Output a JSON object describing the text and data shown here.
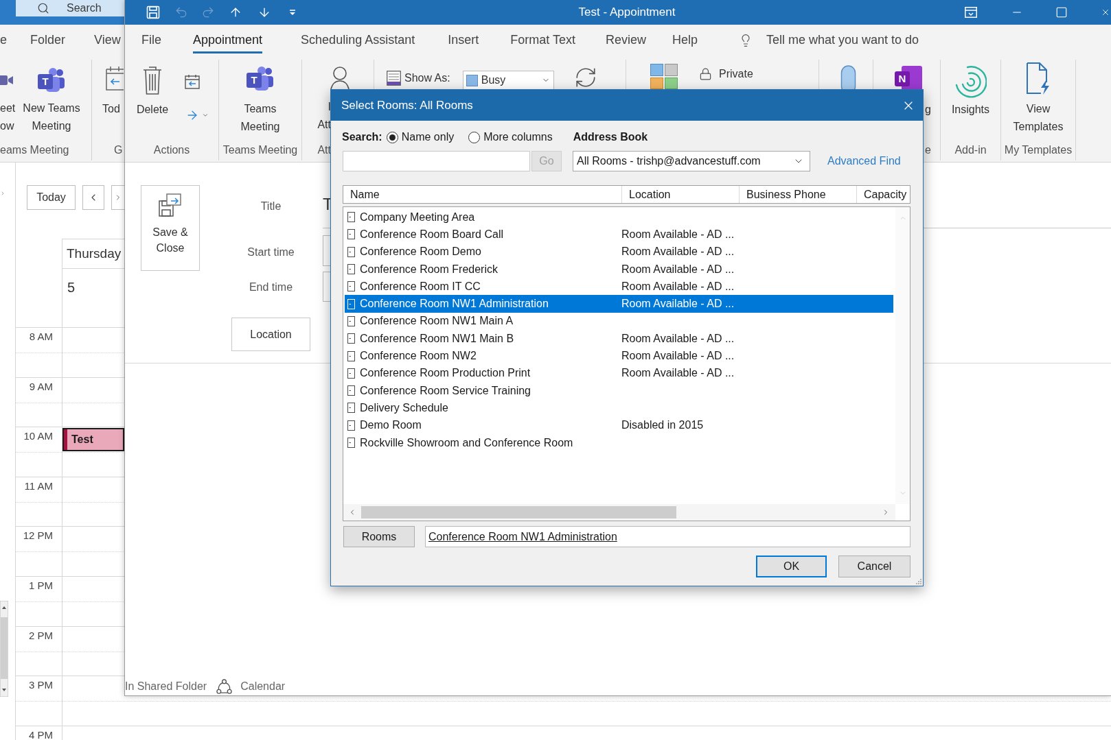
{
  "main_window": {
    "search": {
      "placeholder": "Search"
    },
    "tabs": [
      {
        "label": "e",
        "selected": false
      },
      {
        "label": "Folder",
        "selected": false
      },
      {
        "label": "View",
        "selected": false
      }
    ],
    "ribbon": {
      "buttons": [
        {
          "lines": [
            "eet",
            "ow"
          ]
        },
        {
          "lines": [
            "New Teams",
            "Meeting"
          ],
          "logo_letter": "T"
        },
        {
          "lines": [
            "Tod"
          ]
        }
      ],
      "groups": [
        "eams Meeting",
        "G"
      ]
    },
    "calendar": {
      "today_button": "Today",
      "day": {
        "weekday": "Thursday",
        "date": "5"
      },
      "hours": [
        {
          "label": "8 AM"
        },
        {
          "label": "9 AM"
        },
        {
          "label": "10 AM",
          "events": [
            {
              "title": "Test"
            }
          ]
        },
        {
          "label": "11 AM"
        },
        {
          "label": "12 PM"
        },
        {
          "label": "1 PM"
        },
        {
          "label": "2 PM"
        },
        {
          "label": "3 PM"
        },
        {
          "label": "4 PM"
        }
      ]
    }
  },
  "appointment_window": {
    "title": "Test - Appointment",
    "quick_access": [
      {
        "disabled": false
      },
      {
        "disabled": true
      },
      {
        "disabled": true
      },
      {
        "disabled": false
      },
      {
        "disabled": false
      }
    ],
    "tabs": [
      {
        "label": "File",
        "selected": false
      },
      {
        "label": "Appointment",
        "selected": true
      },
      {
        "label": "Scheduling Assistant",
        "selected": false
      },
      {
        "label": "Insert",
        "selected": false
      },
      {
        "label": "Format Text",
        "selected": false
      },
      {
        "label": "Review",
        "selected": false
      },
      {
        "label": "Help",
        "selected": false
      }
    ],
    "tell_me": {
      "placeholder": "Tell me what you want to do"
    },
    "ribbon": {
      "actions": {
        "label": "Actions",
        "delete": "Delete"
      },
      "teams_meeting": {
        "label": "Teams Meeting",
        "lines": [
          "Teams",
          "Meeting"
        ],
        "logo_letter": "T"
      },
      "attendees": {
        "label": "Att",
        "lines": [
          "I",
          "Att"
        ]
      },
      "show_as": {
        "label": "Show As:",
        "value": "Busy"
      },
      "private": {
        "label": "Private"
      },
      "meeting_notes": {
        "label": "e",
        "lines": [
          "g"
        ],
        "logo_letter": "N"
      },
      "add_in": {
        "label": "Add-in",
        "lines": [
          "Insights"
        ]
      },
      "my_templates": {
        "label": "My Templates",
        "lines": [
          "View",
          "Templates"
        ]
      }
    },
    "form": {
      "save_close": "Save & Close",
      "title": {
        "label": "Title",
        "value": "T"
      },
      "start_time": {
        "label": "Start time"
      },
      "end_time": {
        "label": "End time"
      },
      "location_button": "Location"
    },
    "footer": {
      "prefix": "In Shared Folder",
      "folder": "Calendar"
    }
  },
  "dialog": {
    "title": "Select Rooms: All Rooms",
    "search_label": "Search:",
    "search_modes": [
      {
        "label": "Name only",
        "selected": true
      },
      {
        "label": "More columns",
        "selected": false
      }
    ],
    "go_button": {
      "label": "Go",
      "disabled": true
    },
    "address_book_label": "Address Book",
    "address_book": {
      "value": "All Rooms - trishp@advancestuff.com"
    },
    "advanced_find": "Advanced Find",
    "columns": [
      "Name",
      "Location",
      "Business Phone",
      "Capacity"
    ],
    "rows": [
      {
        "name": "Company Meeting Area",
        "selected": false
      },
      {
        "name": "Conference Room Board Call",
        "location": "Room Available - AD ...",
        "selected": false
      },
      {
        "name": "Conference Room Demo",
        "location": "Room Available - AD ...",
        "selected": false
      },
      {
        "name": "Conference Room Frederick",
        "location": "Room Available - AD ...",
        "selected": false
      },
      {
        "name": "Conference Room IT CC",
        "location": "Room Available - AD ...",
        "selected": false
      },
      {
        "name": "Conference Room NW1 Administration",
        "location": "Room Available - AD ...",
        "selected": true
      },
      {
        "name": "Conference Room NW1 Main A",
        "selected": false
      },
      {
        "name": "Conference Room NW1 Main B",
        "location": "Room Available - AD ...",
        "selected": false
      },
      {
        "name": "Conference Room NW2",
        "location": "Room Available - AD ...",
        "selected": false
      },
      {
        "name": "Conference Room Production Print",
        "location": "Room Available - AD ...",
        "selected": false
      },
      {
        "name": "Conference Room Service Training",
        "selected": false
      },
      {
        "name": "Delivery Schedule",
        "selected": false
      },
      {
        "name": "Demo Room",
        "location": "Disabled in 2015",
        "selected": false
      },
      {
        "name": "Rockville Showroom and Conference Room",
        "selected": false
      }
    ],
    "rooms_button": "Rooms",
    "rooms_value": "Conference Room NW1 Administration",
    "buttons": [
      {
        "label": "OK",
        "default": true
      },
      {
        "label": "Cancel",
        "default": false
      }
    ]
  }
}
